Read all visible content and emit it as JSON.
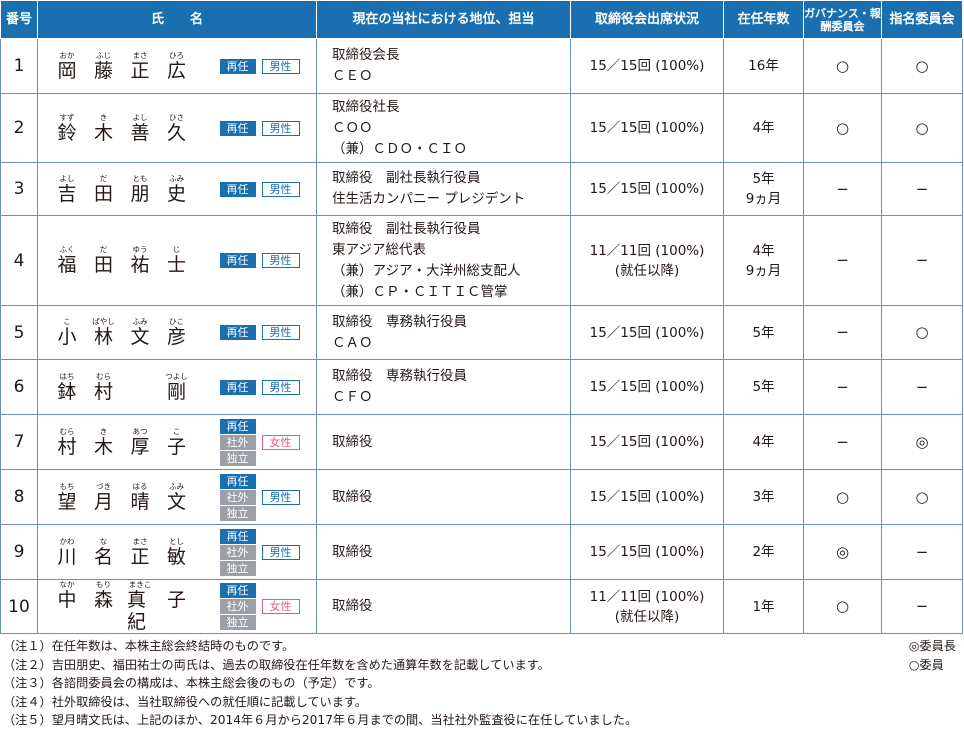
{
  "header": {
    "num": "番号",
    "name": "氏　　名",
    "position": "現在の当社における地位、担当",
    "attendance": "取締役会出席状況",
    "tenure": "在任年数",
    "governance": "ガバナンス・報酬委員会",
    "nomination": "指名委員会"
  },
  "rows": [
    {
      "num": "1",
      "chars": [
        [
          "おか",
          "岡"
        ],
        [
          "ふじ",
          "藤"
        ],
        [
          "まさ",
          "正"
        ],
        [
          "ひろ",
          "広"
        ]
      ],
      "tags": [
        "再任"
      ],
      "gender": "男性",
      "position": [
        "取締役会長",
        "ＣＥＯ"
      ],
      "attendance": [
        "15／15回 (100%)"
      ],
      "tenure": [
        "16年"
      ],
      "governance": "○",
      "nomination": "○"
    },
    {
      "num": "2",
      "chars": [
        [
          "すず",
          "鈴"
        ],
        [
          "き",
          "木"
        ],
        [
          "よし",
          "善"
        ],
        [
          "ひさ",
          "久"
        ]
      ],
      "tags": [
        "再任"
      ],
      "gender": "男性",
      "position": [
        "取締役社長",
        "ＣＯＯ",
        "（兼）ＣＤＯ・ＣＩＯ"
      ],
      "attendance": [
        "15／15回 (100%)"
      ],
      "tenure": [
        "4年"
      ],
      "governance": "○",
      "nomination": "○"
    },
    {
      "num": "3",
      "chars": [
        [
          "よし",
          "吉"
        ],
        [
          "だ",
          "田"
        ],
        [
          "とも",
          "朋"
        ],
        [
          "ふみ",
          "史"
        ]
      ],
      "tags": [
        "再任"
      ],
      "gender": "男性",
      "position": [
        "取締役　副社長執行役員",
        "住生活カンパニー プレジデント"
      ],
      "attendance": [
        "15／15回 (100%)"
      ],
      "tenure": [
        "5年",
        "9ヵ月"
      ],
      "governance": "−",
      "nomination": "−"
    },
    {
      "num": "4",
      "chars": [
        [
          "ふく",
          "福"
        ],
        [
          "だ",
          "田"
        ],
        [
          "ゆう",
          "祐"
        ],
        [
          "じ",
          "士"
        ]
      ],
      "tags": [
        "再任"
      ],
      "gender": "男性",
      "position": [
        "取締役　副社長執行役員",
        "東アジア総代表",
        "（兼）アジア・大洋州総支配人",
        "（兼）ＣＰ・ＣＩＴＩＣ管掌"
      ],
      "attendance": [
        "11／11回 (100%)",
        "(就任以降)"
      ],
      "tenure": [
        "4年",
        "9ヵ月"
      ],
      "governance": "−",
      "nomination": "−"
    },
    {
      "num": "5",
      "chars": [
        [
          "こ",
          "小"
        ],
        [
          "ばやし",
          "林"
        ],
        [
          "ふみ",
          "文"
        ],
        [
          "ひこ",
          "彦"
        ]
      ],
      "tags": [
        "再任"
      ],
      "gender": "男性",
      "position": [
        "取締役　専務執行役員",
        "ＣＡＯ"
      ],
      "attendance": [
        "15／15回 (100%)"
      ],
      "tenure": [
        "5年"
      ],
      "governance": "−",
      "nomination": "○"
    },
    {
      "num": "6",
      "chars": [
        [
          "はち",
          "鉢"
        ],
        [
          "むら",
          "村"
        ],
        [
          "",
          ""
        ],
        [
          "つよし",
          "剛"
        ]
      ],
      "tags": [
        "再任"
      ],
      "gender": "男性",
      "position": [
        "取締役　専務執行役員",
        "ＣＦＯ"
      ],
      "attendance": [
        "15／15回 (100%)"
      ],
      "tenure": [
        "5年"
      ],
      "governance": "−",
      "nomination": "−"
    },
    {
      "num": "7",
      "chars": [
        [
          "むら",
          "村"
        ],
        [
          "き",
          "木"
        ],
        [
          "あつ",
          "厚"
        ],
        [
          "こ",
          "子"
        ]
      ],
      "tags": [
        "再任",
        "社外",
        "独立"
      ],
      "gender": "女性",
      "position": [
        "取締役"
      ],
      "attendance": [
        "15／15回 (100%)"
      ],
      "tenure": [
        "4年"
      ],
      "governance": "−",
      "nomination": "◎"
    },
    {
      "num": "8",
      "chars": [
        [
          "もち",
          "望"
        ],
        [
          "づき",
          "月"
        ],
        [
          "はる",
          "晴"
        ],
        [
          "ふみ",
          "文"
        ]
      ],
      "tags": [
        "再任",
        "社外",
        "独立"
      ],
      "gender": "男性",
      "position": [
        "取締役"
      ],
      "attendance": [
        "15／15回 (100%)"
      ],
      "tenure": [
        "3年"
      ],
      "governance": "○",
      "nomination": "○"
    },
    {
      "num": "9",
      "chars": [
        [
          "かわ",
          "川"
        ],
        [
          "な",
          "名"
        ],
        [
          "まさ",
          "正"
        ],
        [
          "とし",
          "敏"
        ]
      ],
      "tags": [
        "再任",
        "社外",
        "独立"
      ],
      "gender": "男性",
      "position": [
        "取締役"
      ],
      "attendance": [
        "15／15回 (100%)"
      ],
      "tenure": [
        "2年"
      ],
      "governance": "◎",
      "nomination": "−"
    },
    {
      "num": "10",
      "chars": [
        [
          "なか",
          "中"
        ],
        [
          "もり",
          "森"
        ],
        [
          "まきこ",
          "真紀"
        ],
        [
          "",
          "子"
        ]
      ],
      "tags": [
        "再任",
        "社外",
        "独立"
      ],
      "gender": "女性",
      "position": [
        "取締役"
      ],
      "attendance": [
        "11／11回 (100%)",
        "(就任以降)"
      ],
      "tenure": [
        "1年"
      ],
      "governance": "○",
      "nomination": "−"
    }
  ],
  "notes": [
    "（注１）在任年数は、本株主総会終結時のものです。",
    "（注２）吉田朋史、福田祐士の両氏は、過去の取締役在任年数を含めた通算年数を記載しています。",
    "（注３）各諮問委員会の構成は、本株主総会後のもの（予定）です。",
    "（注４）社外取締役は、当社取締役への就任順に記載しています。",
    "（注５）望月晴文氏は、上記のほか、2014年６月から2017年６月までの間、当社社外監査役に在任していました。"
  ],
  "legend": [
    "◎委員長",
    "○委員"
  ],
  "colors": {
    "header": "#1a6fb0",
    "tag_reappoint": "#1a6fb0",
    "tag_outside": "#9aa0a6",
    "male": "#1a6fb0",
    "female": "#e05a8a"
  }
}
